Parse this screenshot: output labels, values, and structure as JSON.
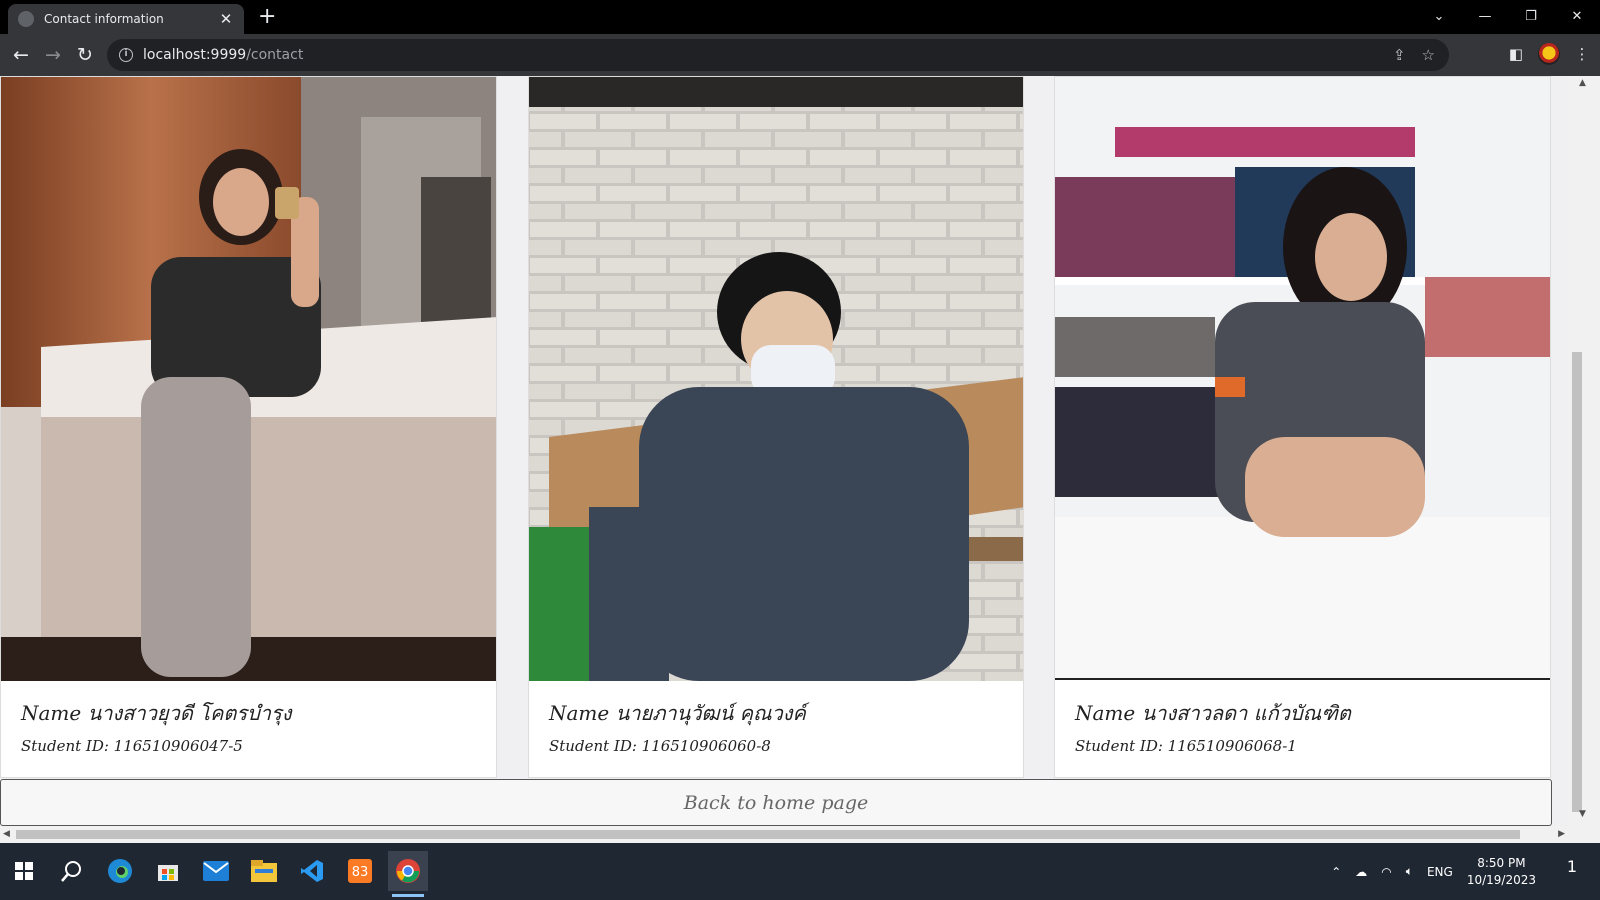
{
  "browser": {
    "tab_title": "Contact information",
    "tab_close": "✕",
    "new_tab": "+",
    "url_host": "localhost:9999",
    "url_path": "/contact",
    "window_controls": [
      "⌄",
      "—",
      "❐",
      "✕"
    ]
  },
  "contacts": [
    {
      "name": "Name นางสาวยุวดี โคตรบำรุง",
      "student_id": "Student ID: 116510906047-5"
    },
    {
      "name": "Name นายภานุวัฒน์ คุณวงค์",
      "student_id": "Student ID: 116510906060-8"
    },
    {
      "name": "Name นางสาวลดา แก้วบัณฑิต",
      "student_id": "Student ID: 116510906068-1"
    }
  ],
  "back_button_label": "Back to home page",
  "taskbar": {
    "language": "ENG",
    "time": "8:50 PM",
    "date": "10/19/2023",
    "notifications": "1"
  }
}
